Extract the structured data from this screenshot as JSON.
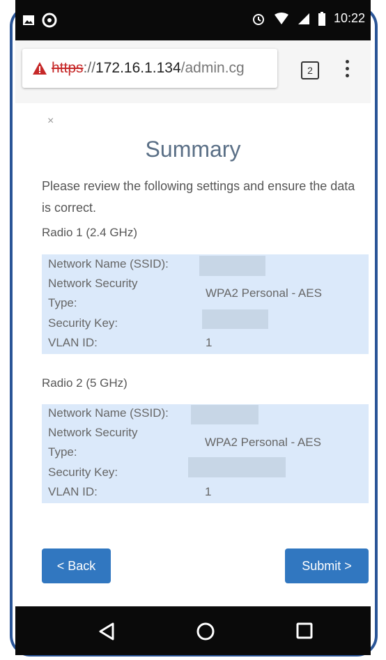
{
  "status_bar": {
    "time": "10:22",
    "icons": [
      "image-icon",
      "notification-icon",
      "alarm-icon",
      "wifi-icon",
      "signal-icon",
      "battery-icon"
    ]
  },
  "browser": {
    "url_scheme": "https",
    "url_separator": "://",
    "url_host": "172.16.1.134",
    "url_path": "/admin.cg",
    "tab_count": "2",
    "warning_color": "#c62828"
  },
  "dialog": {
    "close_symbol": "×",
    "title": "Summary",
    "intro": "Please review the following settings and ensure the data is correct."
  },
  "labels": {
    "ssid": "Network Name (SSID):",
    "security_line1": "Network Security",
    "security_line2": "Type:",
    "key": "Security Key:",
    "vlan": "VLAN ID:"
  },
  "radios": [
    {
      "heading": "Radio 1 (2.4 GHz)",
      "security_type": "WPA2 Personal - AES",
      "vlan_id": "1"
    },
    {
      "heading": "Radio 2 (5 GHz)",
      "security_type": "WPA2 Personal - AES",
      "vlan_id": "1"
    }
  ],
  "buttons": {
    "back": "< Back",
    "submit": "Submit >"
  },
  "colors": {
    "accent": "#3177c0",
    "panel": "#dbe9fa",
    "frame": "#2a5597"
  }
}
